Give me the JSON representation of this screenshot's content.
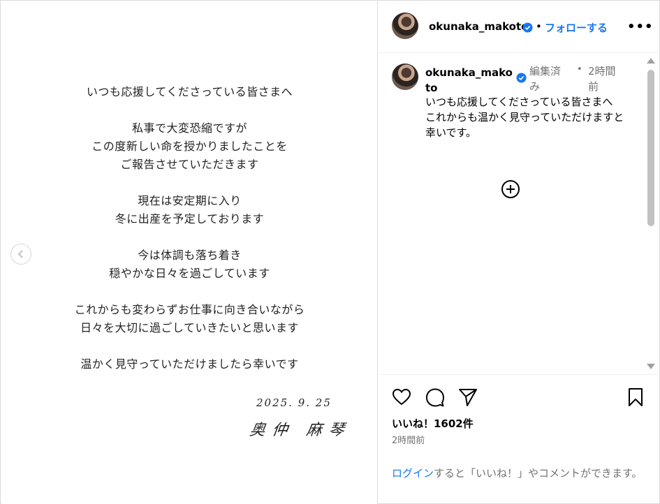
{
  "letter": {
    "paragraphs": [
      [
        "いつも応援してくださっている皆さまへ"
      ],
      [
        "私事で大変恐縮ですが",
        "この度新しい命を授かりましたことを",
        "ご報告させていただきます"
      ],
      [
        "現在は安定期に入り",
        "冬に出産を予定しております"
      ],
      [
        "今は体調も落ち着き",
        "穏やかな日々を過ごしています"
      ],
      [
        "これからも変わらずお仕事に向き合いながら",
        "日々を大切に過ごしていきたいと思います"
      ],
      [
        "温かく見守っていただけましたら幸いです"
      ]
    ],
    "date": "2025. 9. 25",
    "signature": "奥仲 麻琴"
  },
  "header": {
    "username": "okunaka_makoto",
    "separator": "•",
    "follow_label": "フォローする",
    "more_label": "•••"
  },
  "comment": {
    "username": "okunaka_makoto",
    "edited": "編集済み",
    "separator": "•",
    "time": "2時間前",
    "text_lines": [
      "いつも応援してくださっている皆さまへ",
      "これからも温かく見守っていただけますと幸いです。"
    ]
  },
  "icons": {
    "prev": "chevron-left-icon",
    "verified": "verified-badge-icon",
    "more": "more-options-icon",
    "expand": "plus-circle-icon",
    "like": "heart-icon",
    "comment": "comment-icon",
    "share": "send-icon",
    "save": "bookmark-icon"
  },
  "stats": {
    "likes": "いいね！1602件",
    "posted": "2時間前"
  },
  "login_prompt": {
    "link": "ログイン",
    "rest": "すると「いいね！」やコメントができます。"
  },
  "colors": {
    "accent": "#1877f2",
    "muted": "#737373",
    "border": "#dbdbdb"
  }
}
